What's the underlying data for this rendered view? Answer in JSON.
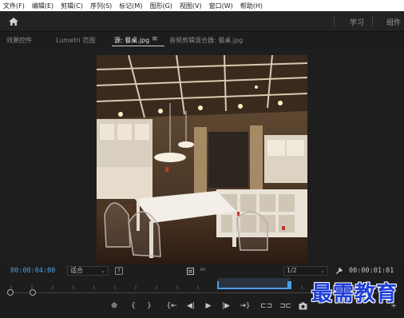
{
  "menubar": {
    "items": [
      "文件(F)",
      "编辑(E)",
      "剪辑(C)",
      "序列(S)",
      "标记(M)",
      "图形(G)",
      "视图(V)",
      "窗口(W)",
      "帮助(H)"
    ]
  },
  "workspace": {
    "tabs": [
      "学习",
      "组件"
    ]
  },
  "panels": {
    "tabs": [
      "效果控件",
      "Lumetri 范围",
      "源: 餐桌.jpg",
      "音频剪辑混合器: 餐桌.jpg"
    ]
  },
  "source_monitor": {
    "current_time": "00:00:04:00",
    "fit_select": "适合",
    "resolution_select": "1/2",
    "duration": "00:00:01:01"
  },
  "icons": {
    "home": "home-icon",
    "settings": "wrench-icon",
    "menu": "hamburger-icon",
    "export_frame": "camera-icon"
  },
  "colors": {
    "accent": "#4a9fe8",
    "watermark": "#1f3fd6"
  },
  "watermark": "最需教育"
}
